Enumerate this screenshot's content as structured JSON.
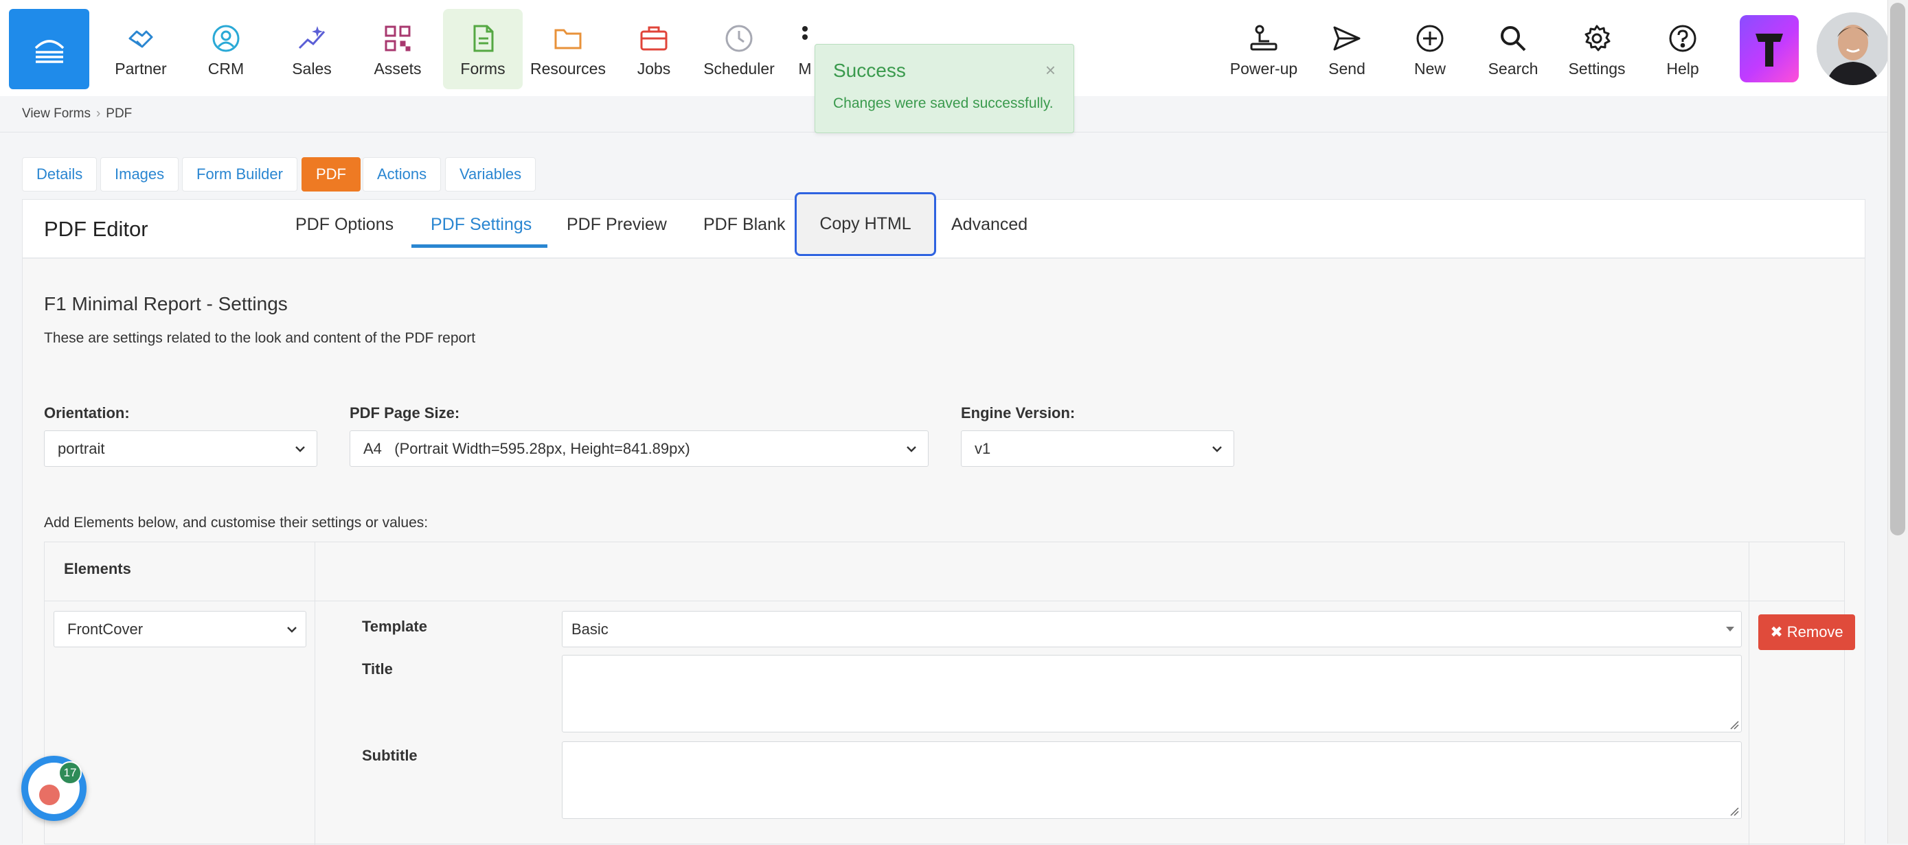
{
  "nav": {
    "items": [
      {
        "label": "Partner",
        "icon": "handshake-icon"
      },
      {
        "label": "CRM",
        "icon": "user-circle-icon"
      },
      {
        "label": "Sales",
        "icon": "sparkle-chart-icon"
      },
      {
        "label": "Assets",
        "icon": "qr-code-icon"
      },
      {
        "label": "Forms",
        "icon": "document-icon"
      },
      {
        "label": "Resources",
        "icon": "folder-icon"
      },
      {
        "label": "Jobs",
        "icon": "briefcase-icon"
      },
      {
        "label": "Scheduler",
        "icon": "clock-icon"
      },
      {
        "label": "M",
        "icon": "more-vertical-icon"
      }
    ],
    "right_items": [
      {
        "label": "Power-up",
        "icon": "power-up-icon"
      },
      {
        "label": "Send",
        "icon": "send-icon"
      },
      {
        "label": "New",
        "icon": "plus-circle-icon"
      },
      {
        "label": "Search",
        "icon": "search-icon"
      },
      {
        "label": "Settings",
        "icon": "gear-icon"
      },
      {
        "label": "Help",
        "icon": "help-circle-icon"
      }
    ],
    "active": "Forms",
    "brand_color": "#1f8bea",
    "active_bg": "#e8f4e3"
  },
  "breadcrumb": [
    "View Forms",
    "PDF"
  ],
  "toast": {
    "title": "Success",
    "message": "Changes were saved successfully.",
    "close": "×"
  },
  "top_tabs": [
    "Details",
    "Images",
    "Form Builder",
    "PDF",
    "Actions",
    "Variables"
  ],
  "top_tab_active": "PDF",
  "panel": {
    "title": "PDF Editor",
    "sub_tabs": [
      "PDF Options",
      "PDF Settings",
      "PDF Preview",
      "PDF Blank",
      "Copy HTML",
      "Advanced"
    ],
    "sub_tab_active": "PDF Settings",
    "sub_tab_focused": "Copy HTML"
  },
  "settings": {
    "title": "F1 Minimal Report - Settings",
    "description": "These are settings related to the look and content of the PDF report",
    "orientation": {
      "label": "Orientation:",
      "value": "portrait"
    },
    "page_size": {
      "label": "PDF Page Size:",
      "value": "A4   (Portrait Width=595.28px, Height=841.89px)"
    },
    "engine": {
      "label": "Engine Version:",
      "value": "v1"
    },
    "add_elements_text": "Add Elements below, and customise their settings or values:"
  },
  "elements": {
    "header": "Elements",
    "selected": "FrontCover",
    "props": {
      "template_label": "Template",
      "template_value": "Basic",
      "title_label": "Title",
      "subtitle_label": "Subtitle"
    },
    "remove_label": "Remove"
  },
  "chat": {
    "badge": "17"
  }
}
